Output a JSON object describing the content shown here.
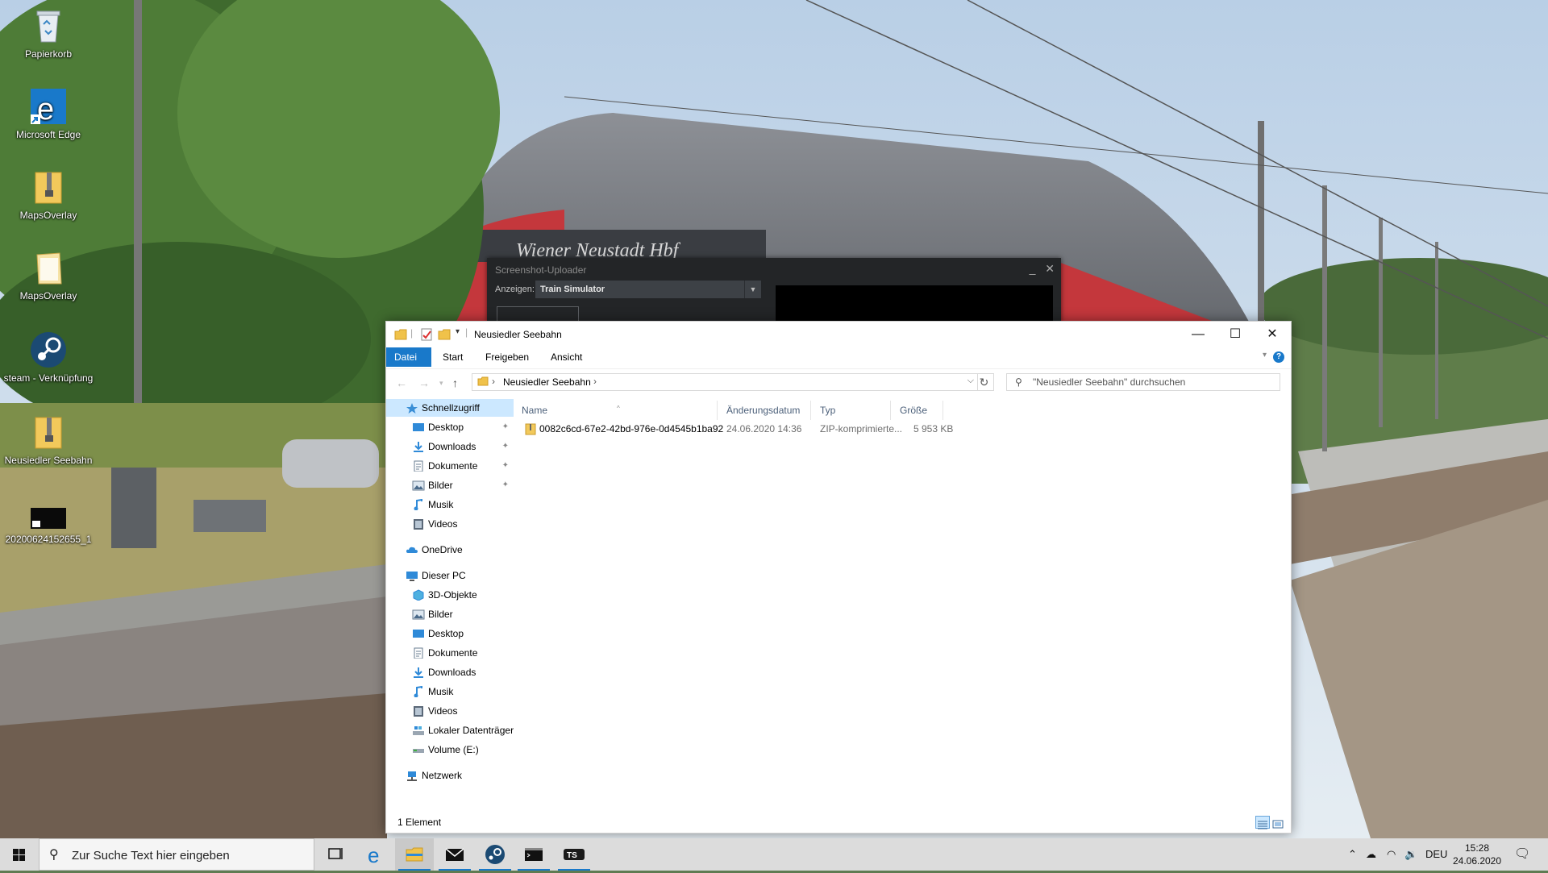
{
  "desktop": {
    "icons": [
      {
        "label": "Papierkorb"
      },
      {
        "label": "Microsoft Edge"
      },
      {
        "label": "MapsOverlay"
      },
      {
        "label": "MapsOverlay"
      },
      {
        "label": "steam - Verknüpfung"
      },
      {
        "label": "Neusiedler Seebahn"
      },
      {
        "label": "20200624152655_1"
      }
    ]
  },
  "uploader": {
    "title": "Screenshot-Uploader",
    "minimize": "_",
    "close": "✕",
    "show_label": "Anzeigen:",
    "show_value": "Train Simulator"
  },
  "explorer": {
    "title": "Neusiedler Seebahn",
    "ribbon_tabs": [
      "Datei",
      "Start",
      "Freigeben",
      "Ansicht"
    ],
    "address_crumb": "Neusiedler Seebahn",
    "search_placeholder": "\"Neusiedler Seebahn\" durchsuchen",
    "nav": {
      "quick_access": "Schnellzugriff",
      "quick_items": [
        "Desktop",
        "Downloads",
        "Dokumente",
        "Bilder",
        "Musik",
        "Videos"
      ],
      "onedrive": "OneDrive",
      "this_pc": "Dieser PC",
      "pc_items": [
        "3D-Objekte",
        "Bilder",
        "Desktop",
        "Dokumente",
        "Downloads",
        "Musik",
        "Videos",
        "Lokaler Datenträger",
        "Volume (E:)"
      ],
      "network": "Netzwerk"
    },
    "columns": {
      "name": "Name",
      "date": "Änderungsdatum",
      "type": "Typ",
      "size": "Größe"
    },
    "files": [
      {
        "name": "0082c6cd-67e2-42bd-976e-0d4545b1ba92",
        "date": "24.06.2020 14:36",
        "type": "ZIP-komprimierte...",
        "size": "5 953 KB"
      }
    ],
    "status": "1 Element"
  },
  "taskbar": {
    "search_placeholder": "Zur Suche Text hier eingeben",
    "lang": "DEU",
    "time": "15:28",
    "date": "24.06.2020"
  },
  "colors": {
    "accent": "#1979ca",
    "selection": "#cce8ff",
    "taskbar": "#dcdcdc"
  }
}
